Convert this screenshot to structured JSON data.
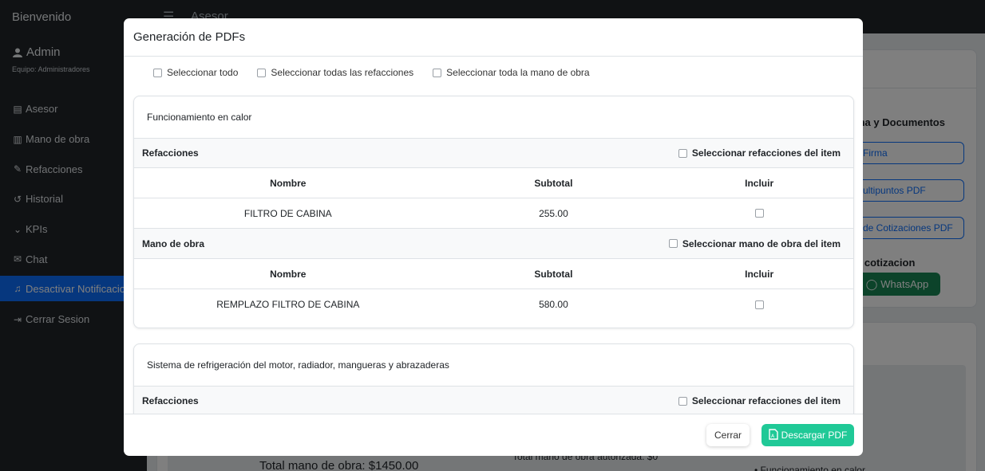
{
  "sidebar": {
    "brand": "Bienvenido",
    "user_name": "Admin",
    "team": "Equipo: Administradores",
    "items": [
      {
        "label": "Asesor",
        "icon": "id-card-icon"
      },
      {
        "label": "Mano de obra",
        "icon": "clipboard-icon"
      },
      {
        "label": "Refacciones",
        "icon": "wrench-icon"
      },
      {
        "label": "Historial",
        "icon": "history-icon"
      },
      {
        "label": "KPIs",
        "icon": "chevron-down-icon"
      },
      {
        "label": "Chat",
        "icon": "chat-icon"
      },
      {
        "label": "Desactivar Notificacion",
        "icon": "bell-icon"
      },
      {
        "label": "Cerrar Sesion",
        "icon": "sign-out-icon"
      }
    ]
  },
  "topbar": {
    "title": "Asesor"
  },
  "background": {
    "section_title": "ma y Documentos",
    "btn_firma": "Firma",
    "btn_multipuntos": "ultipuntos PDF",
    "btn_cotizaciones": "de Cotizaciones PDF",
    "cotizacion_label": "e cotizacion",
    "whatsapp": "WhatsApp",
    "total_mano_obra": "Total mano de obra: $1450.00",
    "total_autorizada": "Total mano de obra autorizada: $0",
    "bullet": "Funcionamiento en calor"
  },
  "modal": {
    "title": "Generación de PDFs",
    "select_all": "Seleccionar todo",
    "select_all_parts": "Seleccionar todas las refacciones",
    "select_all_labor": "Seleccionar toda la mano de obra",
    "items": [
      {
        "name": "Funcionamiento en calor",
        "parts_label": "Refacciones",
        "parts_select": "Seleccionar refacciones del item",
        "labor_label": "Mano de obra",
        "labor_select": "Seleccionar mano de obra del item",
        "col_name": "Nombre",
        "col_subtotal": "Subtotal",
        "col_include": "Incluir",
        "parts": [
          {
            "name": "FILTRO DE CABINA",
            "subtotal": "255.00"
          }
        ],
        "labor": [
          {
            "name": "REMPLAZO FILTRO DE CABINA",
            "subtotal": "580.00"
          }
        ]
      },
      {
        "name": "Sistema de refrigeración del motor, radiador, mangueras y abrazaderas",
        "parts_label": "Refacciones",
        "parts_select": "Seleccionar refacciones del item"
      }
    ],
    "close_label": "Cerrar",
    "download_label": "Descargar PDF"
  },
  "colors": {
    "accent": "#0d6efd",
    "download": "#20c997",
    "whatsapp": "#198754",
    "sidebar": "#212529"
  }
}
